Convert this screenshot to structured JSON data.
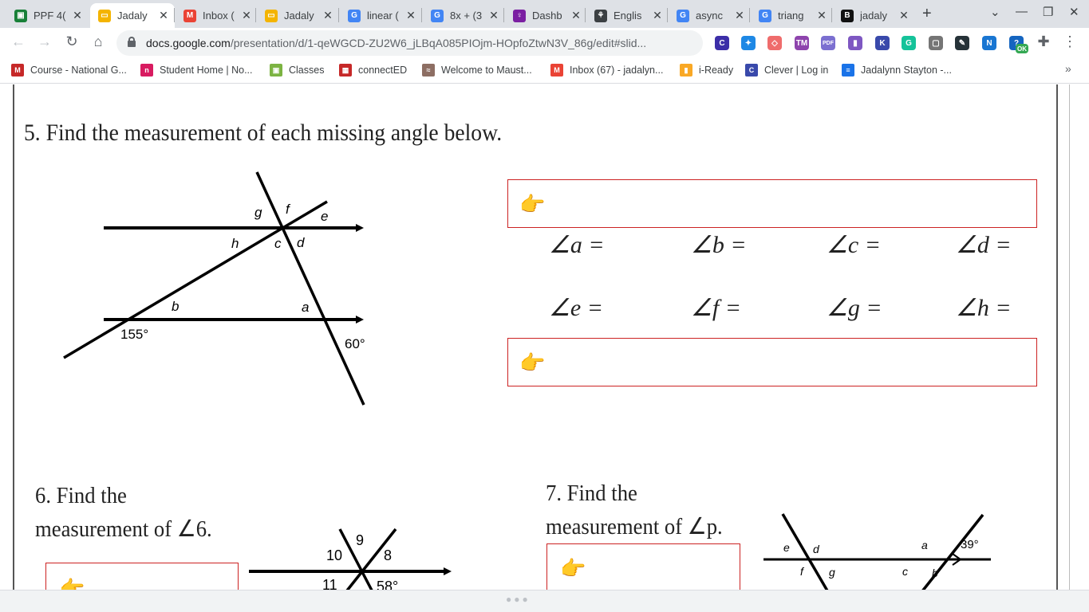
{
  "browser": {
    "tabs": [
      {
        "title": "PPF 4(",
        "favicon": "#188038",
        "glyph": "▣"
      },
      {
        "title": "Jadaly",
        "favicon": "#f4b400",
        "glyph": "▭",
        "active": true
      },
      {
        "title": "Inbox (",
        "favicon": "#ea4335",
        "glyph": "M"
      },
      {
        "title": "Jadaly",
        "favicon": "#f4b400",
        "glyph": "▭"
      },
      {
        "title": "linear (",
        "favicon": "#4285f4",
        "glyph": "G"
      },
      {
        "title": "8x + (3",
        "favicon": "#4285f4",
        "glyph": "G"
      },
      {
        "title": "Dashb",
        "favicon": "#7b1fa2",
        "glyph": "♀"
      },
      {
        "title": "Englis",
        "favicon": "#3c4043",
        "glyph": "⚘"
      },
      {
        "title": "async",
        "favicon": "#4285f4",
        "glyph": "G"
      },
      {
        "title": "triang",
        "favicon": "#4285f4",
        "glyph": "G"
      },
      {
        "title": "jadaly",
        "favicon": "#111111",
        "glyph": "B"
      }
    ],
    "url_host": "docs.google.com",
    "url_path": "/presentation/d/1-qeWGCD-ZU2W6_jLBqA085PIOjm-HOpfoZtwN3V_86g/edit#slid...",
    "bookmarks": [
      {
        "label": "Course - National G...",
        "color": "#c62828",
        "glyph": "M"
      },
      {
        "label": "Student Home | No...",
        "color": "#d81b60",
        "glyph": "n"
      },
      {
        "label": "Classes",
        "color": "#7cb342",
        "glyph": "▣"
      },
      {
        "label": "connectED",
        "color": "#c62828",
        "glyph": "▦"
      },
      {
        "label": "Welcome to Maust...",
        "color": "#8d6e63",
        "glyph": "≈"
      },
      {
        "label": "Inbox (67) - jadalyn...",
        "color": "#ea4335",
        "glyph": "M"
      },
      {
        "label": "i-Ready",
        "color": "#f9a825",
        "glyph": "▮"
      },
      {
        "label": "Clever | Log in",
        "color": "#3949ab",
        "glyph": "C"
      },
      {
        "label": "Jadalynn Stayton -...",
        "color": "#1a73e8",
        "glyph": "≡"
      }
    ],
    "extensions": [
      {
        "glyph": "C",
        "color": "#3c2ea8"
      },
      {
        "glyph": "✦",
        "color": "#1e88e5"
      },
      {
        "glyph": "◇",
        "color": "#ef6c6c"
      },
      {
        "glyph": "TM",
        "color": "#8e44ad"
      },
      {
        "glyph": "PDF",
        "color": "#7b6fd0"
      },
      {
        "glyph": "▮",
        "color": "#7e57c2"
      },
      {
        "glyph": "K",
        "color": "#3949ab"
      },
      {
        "glyph": "G",
        "color": "#15c39a"
      },
      {
        "glyph": "▢",
        "color": "#757575"
      },
      {
        "glyph": "✎",
        "color": "#263238"
      },
      {
        "glyph": "N",
        "color": "#1976d2"
      },
      {
        "glyph": "?",
        "color": "#1565c0"
      }
    ],
    "ext_badge": "OK"
  },
  "slide": {
    "q5_title": "5. Find the measurement of each missing angle below.",
    "q6_line1": "6. Find the",
    "q6_line2": "measurement of ∠6.",
    "q7_line1": "7. Find the",
    "q7_line2": "measurement of ∠p.",
    "hand_glyph": "👉",
    "angles_row1": [
      "∠a =",
      "∠b =",
      "∠c =",
      "∠d ="
    ],
    "angles_row2": [
      "∠e =",
      "∠f =",
      "∠g =",
      "∠h ="
    ],
    "fig5_labels": {
      "g": "g",
      "f": "f",
      "e": "e",
      "h": "h",
      "c": "c",
      "d": "d",
      "b": "b",
      "a": "a",
      "deg155": "155°",
      "deg60": "60°"
    },
    "fig6_labels": {
      "n9": "9",
      "n10": "10",
      "n8": "8",
      "n11": "11",
      "deg58": "58°"
    },
    "fig7_labels": {
      "e": "e",
      "d": "d",
      "a": "a",
      "deg39": "39°",
      "f": "f",
      "g": "g",
      "c": "c",
      "b": "b"
    }
  },
  "colors": {
    "answer_border": "#cc2222",
    "hand": "#f2b52c",
    "tab_bg": "#dee1e6"
  }
}
